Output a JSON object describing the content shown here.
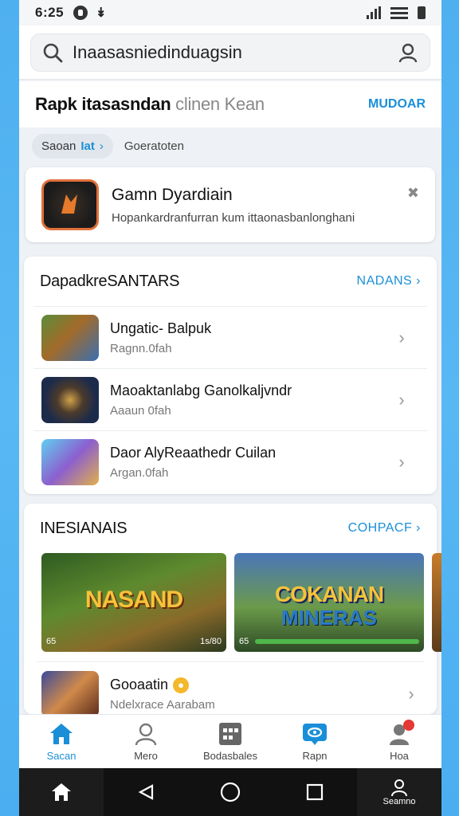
{
  "status": {
    "time": "6:25"
  },
  "search": {
    "value": "Inaasasniedinduagsin"
  },
  "header": {
    "title": "Rapk itasasndan",
    "title_suffix": "clinen Kean",
    "action": "MUDOAR"
  },
  "chips": {
    "chip1_a": "Saoan",
    "chip1_b": "Iat",
    "chip2": "Goeratoten"
  },
  "guardian": {
    "title": "Gamn Dyardiain",
    "subtitle": "Hopankardranfurran kum ittaonasbanlonghani"
  },
  "section1": {
    "title": "DapadkreSANTARS",
    "action": "NADANS",
    "items": [
      {
        "title": "Ungatic- Balpuk",
        "subtitle": "Ragnn.0fah"
      },
      {
        "title": "Maoaktanlabg Ganolkaljvndr",
        "subtitle": "Aaaun 0fah"
      },
      {
        "title": "Daor AlyReaathedr Cuilan",
        "subtitle": "Argan.0fah"
      }
    ]
  },
  "section2": {
    "title": "INESIANAIS",
    "action": "COHPACF",
    "banners": [
      {
        "title": "NASAND",
        "foot_left": "65",
        "foot_right": "1s/80"
      },
      {
        "title": "COKANAN",
        "title2": "MINERAS",
        "foot_left": "65"
      }
    ],
    "item": {
      "title": "Gooaatin",
      "subtitle": "Ndelxrace Aarabam"
    }
  },
  "nav": {
    "items": [
      "Sacan",
      "Mero",
      "Bodasbales",
      "Rapn",
      "Hoa"
    ]
  },
  "sysbar": {
    "last_label": "Seamno"
  },
  "colors": {
    "accent": "#1a8fd8",
    "background": "#4fb0f0"
  }
}
